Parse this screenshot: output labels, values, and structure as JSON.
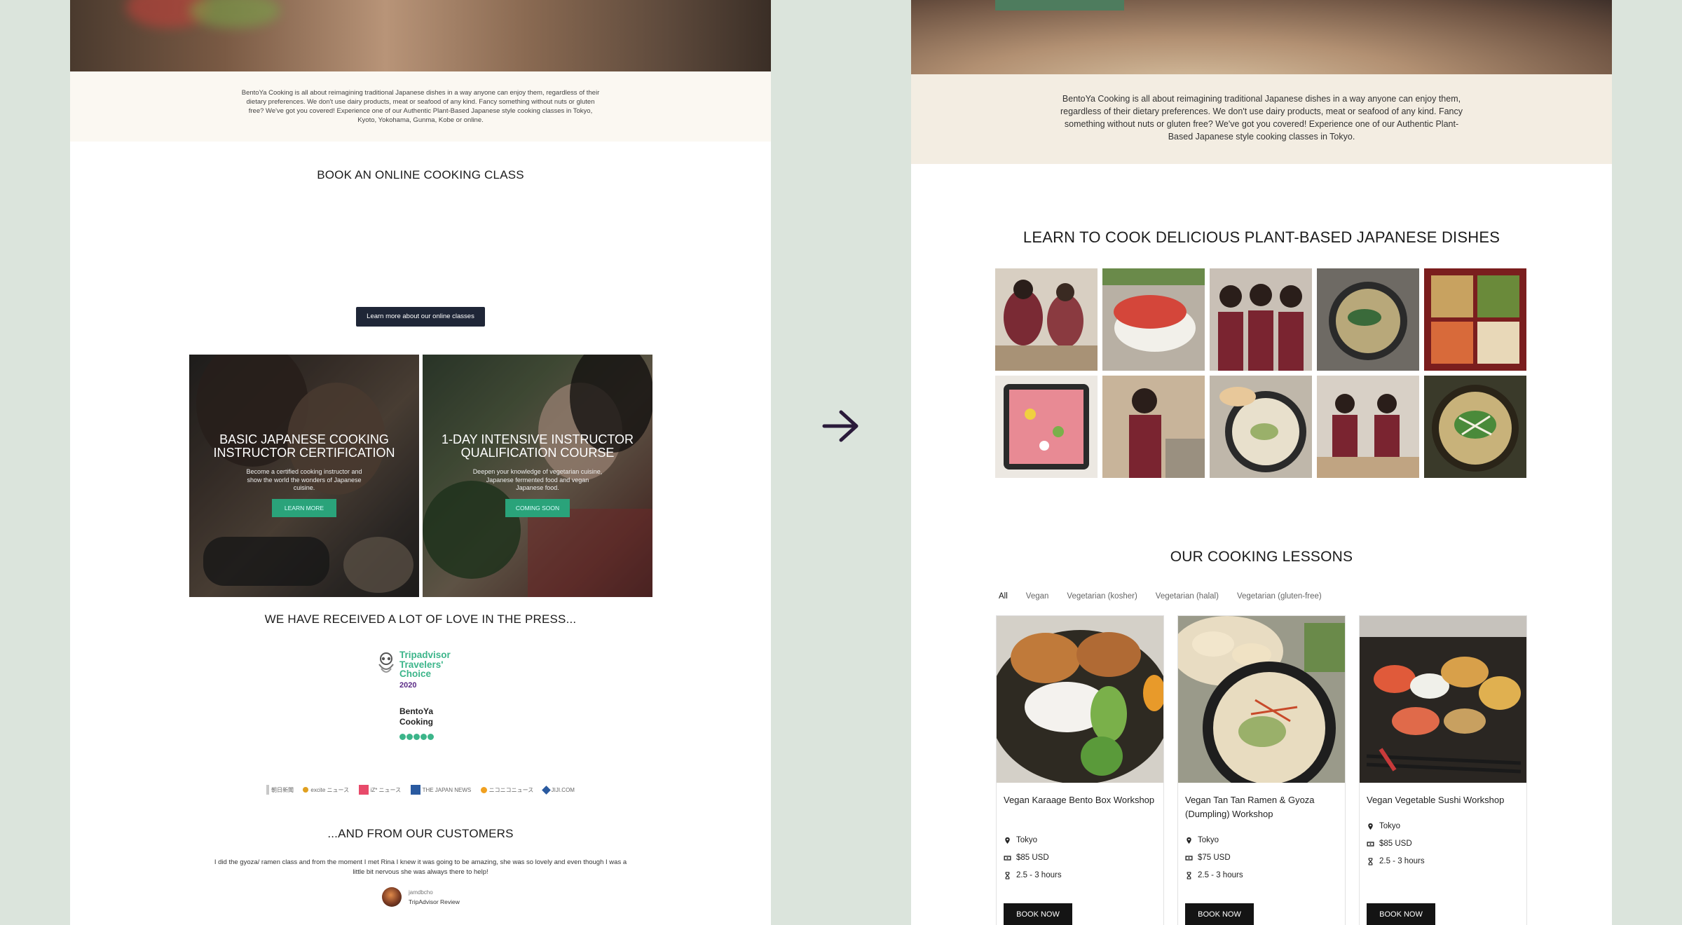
{
  "left_page": {
    "intro_text": "BentoYa Cooking is all about reimagining traditional Japanese dishes in a way anyone can enjoy them, regardless of their dietary preferences. We don't use dairy products, meat or seafood of any kind. Fancy something without nuts or gluten free? We've got you covered! Experience one of our Authentic Plant-Based Japanese style cooking classes in Tokyo, Kyoto, Yokohama, Gunma, Kobe or online.",
    "online_heading": "BOOK AN ONLINE COOKING CLASS",
    "online_button": "Learn more about our online classes",
    "courses": [
      {
        "title": "BASIC JAPANESE COOKING INSTRUCTOR CERTIFICATION",
        "description": "Become a certified cooking instructor and show the world the wonders of Japanese cuisine.",
        "button": "LEARN MORE"
      },
      {
        "title": "1-DAY INTENSIVE INSTRUCTOR QUALIFICATION COURSE",
        "description": "Deepen your knowledge of vegetarian cuisine, Japanese fermented food and vegan Japanese food.",
        "button": "COMING SOON"
      }
    ],
    "press_heading": "WE HAVE RECEIVED A LOT OF LOVE IN THE PRESS...",
    "award": {
      "line1": "Tripadvisor",
      "line2": "Travelers'",
      "line3": "Choice",
      "year": "2020",
      "brand1": "BentoYa",
      "brand2": "Cooking"
    },
    "press_logos": [
      "朝日新聞",
      "excite ニュース",
      "iZ* ニュース",
      "THE JAPAN NEWS",
      "ニコニコニュース",
      "JIJI.COM"
    ],
    "customers_heading": "...AND FROM OUR CUSTOMERS",
    "testimonial": "I did the gyoza/ ramen class and from the moment I met Rina I knew it was going to be amazing, she was so lovely and even though I was a little bit nervous she was always there to help!",
    "reviewer_name": "jamdbcho",
    "reviewer_source": "TripAdvisor Review"
  },
  "right_page": {
    "intro_text": "BentoYa Cooking is all about reimagining traditional Japanese dishes in a way anyone can enjoy them, regardless of their dietary preferences. We don't use dairy products, meat or seafood of any kind. Fancy something without nuts or gluten free? We've got you covered! Experience one of our Authentic Plant-Based Japanese style cooking classes in Tokyo.",
    "learn_heading": "LEARN TO COOK DELICIOUS PLANT-BASED JAPANESE DISHES",
    "lessons_heading": "OUR COOKING LESSONS",
    "filters": [
      "All",
      "Vegan",
      "Vegetarian (kosher)",
      "Vegetarian (halal)",
      "Vegetarian (gluten-free)"
    ],
    "lessons": [
      {
        "name": "Vegan Karaage Bento Box Workshop",
        "location": "Tokyo",
        "price": "$85 USD",
        "duration": "2.5 - 3 hours",
        "button": "BOOK NOW"
      },
      {
        "name": "Vegan Tan Tan Ramen & Gyoza (Dumpling) Workshop",
        "location": "Tokyo",
        "price": "$75 USD",
        "duration": "2.5 - 3 hours",
        "button": "BOOK NOW"
      },
      {
        "name": "Vegan Vegetable Sushi Workshop",
        "location": "Tokyo",
        "price": "$85 USD",
        "duration": "2.5 - 3 hours",
        "button": "BOOK NOW"
      }
    ]
  },
  "colors": {
    "background": "#dbe4dc",
    "cream": "#f3ede2",
    "dark_button": "#1f2637",
    "teal_button": "#2aa37a",
    "tripadvisor_green": "#3cb58a",
    "arrow": "#2a1a3a"
  }
}
